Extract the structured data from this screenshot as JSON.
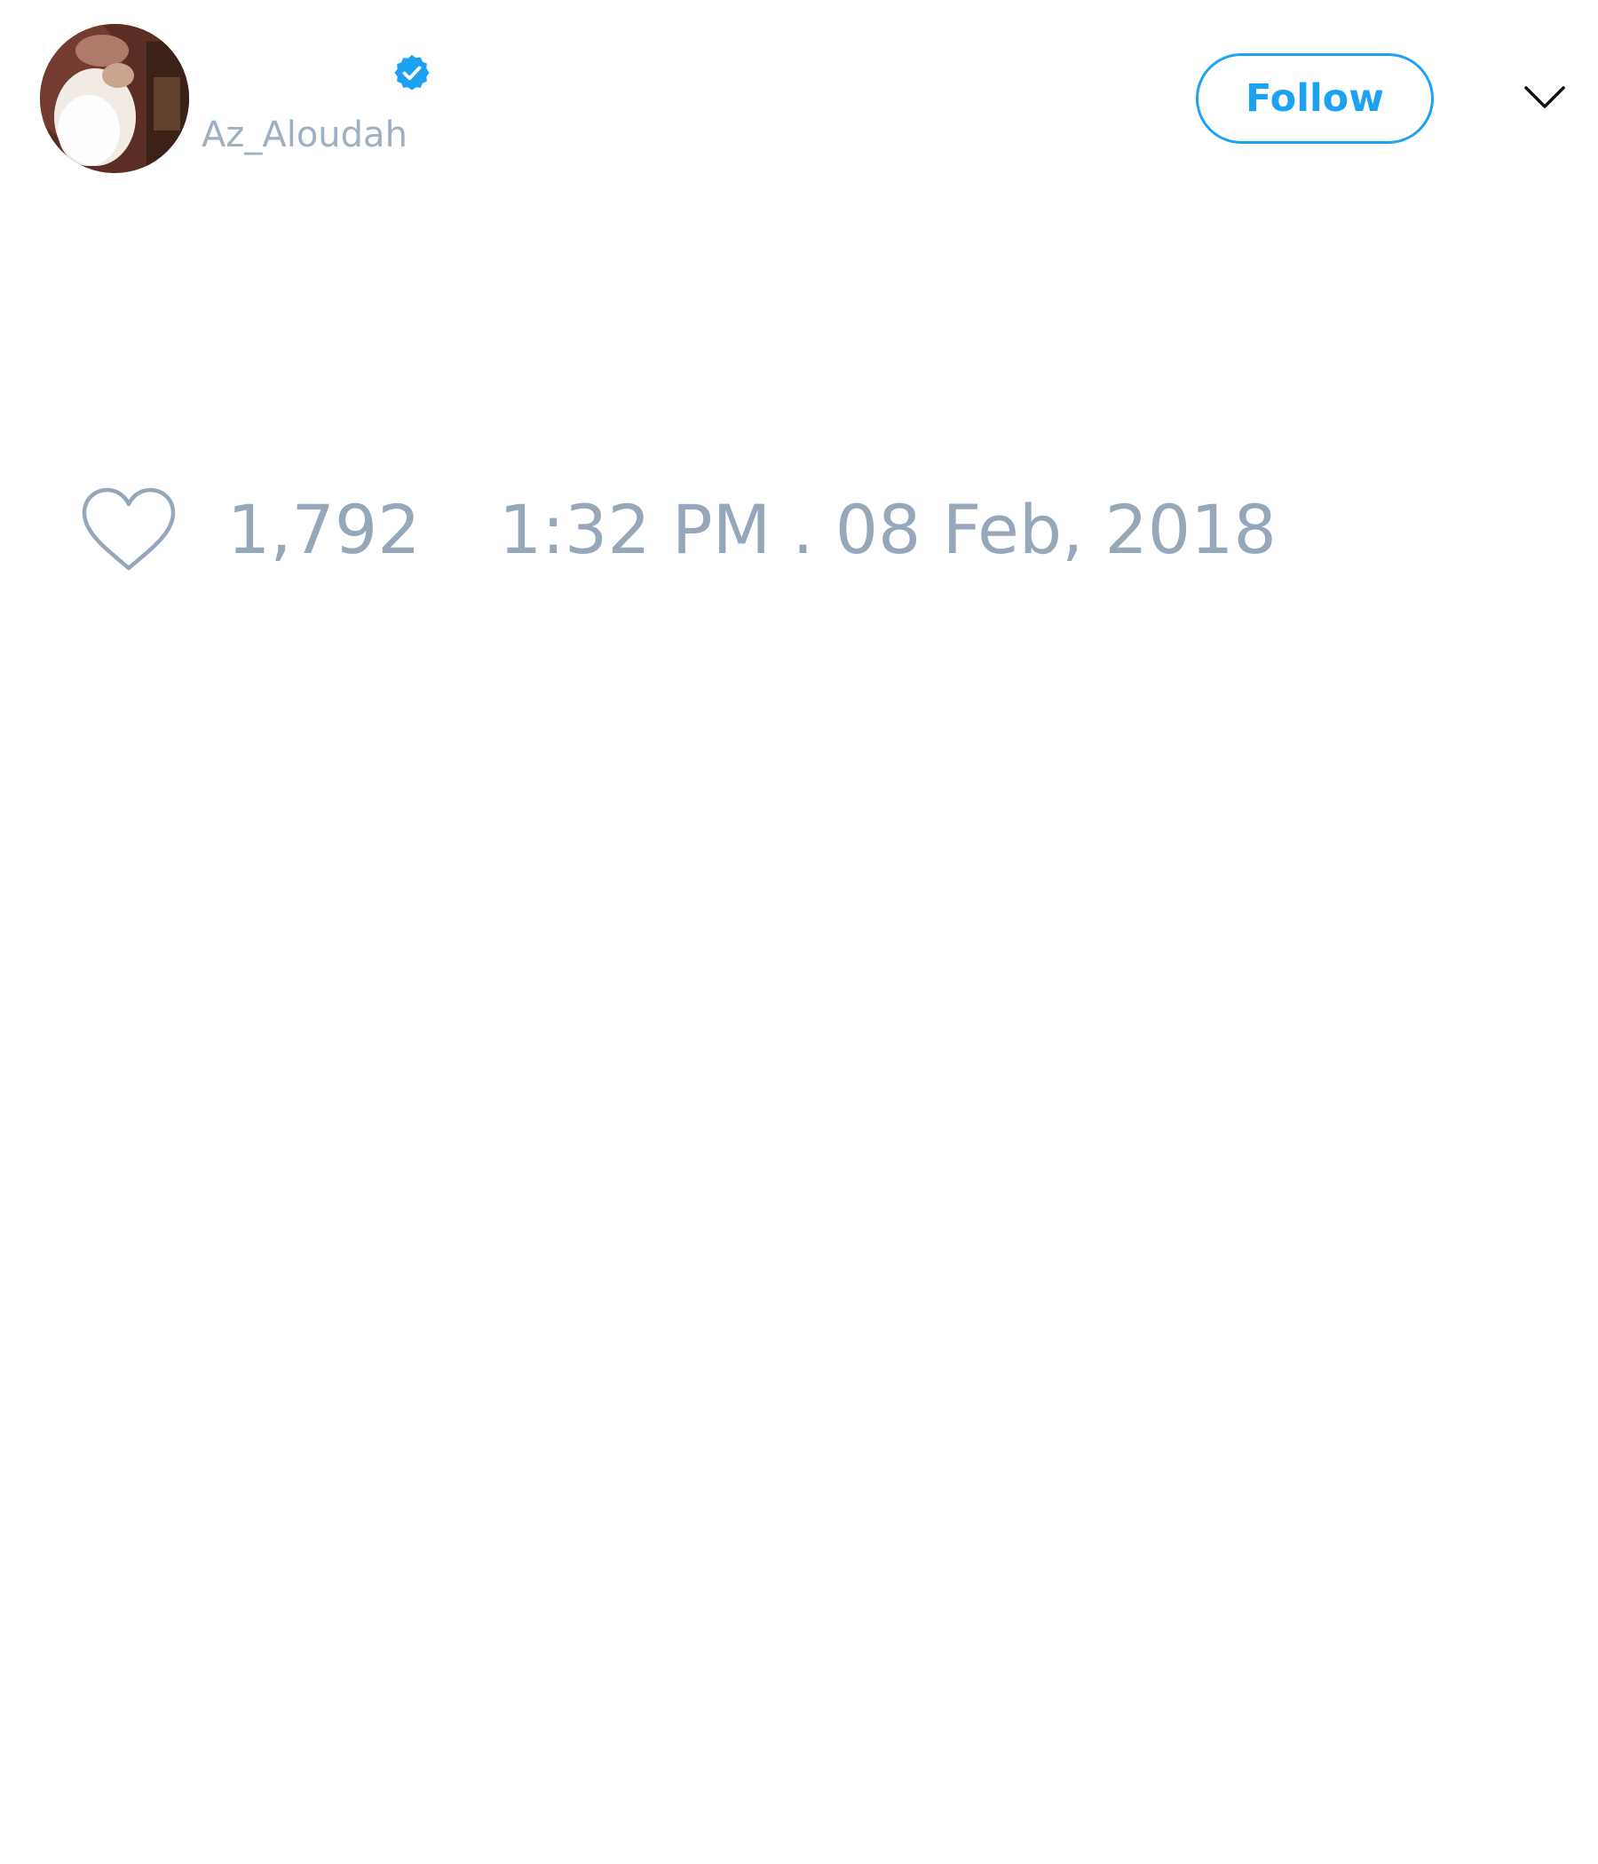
{
  "tweet": {
    "author": {
      "handle": "Az_Aloudah",
      "verified": true,
      "avatar_icon": "profile-photo"
    },
    "follow_label": "Follow",
    "menu_icon": "chevron-down-icon",
    "likes": "1,792",
    "timestamp": "1:32 PM . 08 Feb, 2018"
  },
  "colors": {
    "accent": "#1da1f2",
    "muted_text": "#97a7ba",
    "handle_text": "#9fb0c2",
    "background": "#ffffff"
  }
}
